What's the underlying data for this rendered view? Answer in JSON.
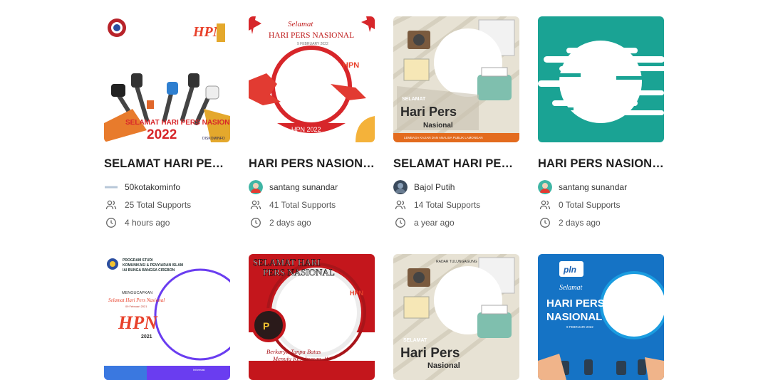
{
  "cards": [
    {
      "title": "SELAMAT HARI PERS ...",
      "author": "50kotakominfo",
      "supports": "25 Total Supports",
      "time": "4 hours ago",
      "img": {
        "hpn_mark": "HPN",
        "text_main": "SELAMAT HARI PERS NASIONAL",
        "text_year": "2022",
        "footer": "DISKOMINFO"
      }
    },
    {
      "title": "HARI PERS NASIONAL",
      "author": "santang sunandar",
      "supports": "41 Total Supports",
      "time": "2 days ago",
      "img": {
        "script": "Selamat",
        "headline": "HARI PERS NASIONAL",
        "date": "9 FEBRUARY 2022",
        "badge": "HPN 2022"
      }
    },
    {
      "title": "SELAMAT HARI PERS ...",
      "author": "Bajol Putih",
      "supports": "14 Total Supports",
      "time": "a year ago",
      "img": {
        "line1": "SELAMAT",
        "line2": "Hari Pers",
        "line3": "Nasional",
        "footer": "LEMBAGA KAJIAN DAN ANALISA PUBLIK LAMONGAN"
      }
    },
    {
      "title": "HARI PERS NASIONAL",
      "author": "santang sunandar",
      "supports": "0 Total Supports",
      "time": "2 days ago",
      "img": {}
    },
    {
      "title": "",
      "author": "",
      "supports": "",
      "time": "",
      "img": {
        "org1": "PROGRAM STUDI",
        "org2": "KOMUNIKASI & PENYIARAN ISLAM",
        "org3": "IAI BUNGA BANGSA CIREBON",
        "greet": "MENGUCAPKAN",
        "script": "Selamat Hari Pers Nasional",
        "date": "09 Februari 2021",
        "hpn": "HPN",
        "year": "2021",
        "info": "Informasi"
      }
    },
    {
      "title": "",
      "author": "",
      "supports": "",
      "time": "",
      "img": {
        "line1": "SELAMAT HARI",
        "line2": "PERS NASIONAL",
        "slogan1": "Berkarya Tanpa Batas",
        "slogan2": "Menuju Kesuksesan..!!"
      }
    },
    {
      "title": "",
      "author": "",
      "supports": "",
      "time": "",
      "img": {
        "top": "RADAR TULUNGAGUNG",
        "line1": "SELAMAT",
        "line2": "Hari Pers",
        "line3": "Nasional"
      }
    },
    {
      "title": "",
      "author": "",
      "supports": "",
      "time": "",
      "img": {
        "logo": "pln",
        "script": "Selamat",
        "headline1": "HARI PERS",
        "headline2": "NASIONAL",
        "date": "9 FEBRUARI 2022"
      }
    }
  ],
  "icons": {
    "supports": "users-icon",
    "time": "clock-icon"
  },
  "colors": {
    "teal": "#1aa394",
    "red": "#d7262a",
    "purple": "#6a3df0"
  }
}
